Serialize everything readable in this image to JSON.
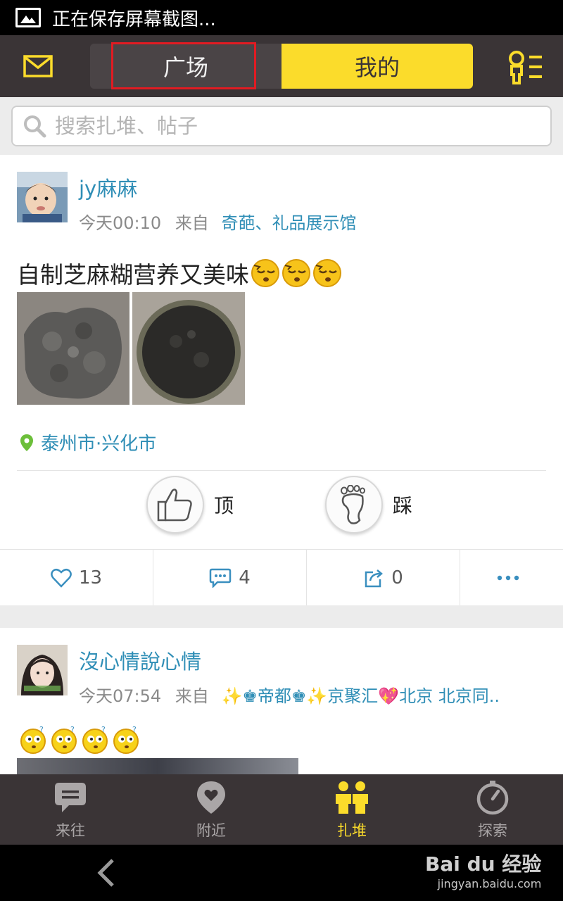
{
  "status_bar": {
    "text": "正在保存屏幕截图..."
  },
  "header": {
    "tabs": [
      {
        "label": "广场"
      },
      {
        "label": "我的"
      }
    ]
  },
  "search": {
    "placeholder": "搜索扎堆、帖子"
  },
  "posts": [
    {
      "username": "jy麻麻",
      "time": "今天00:10",
      "from_label": "来自",
      "from": "奇葩、礼品展示馆",
      "text": "自制芝麻糊营养又美味",
      "location": "泰州市·兴化市",
      "vote_up": "顶",
      "vote_down": "踩",
      "likes": "13",
      "comments": "4",
      "shares": "0"
    },
    {
      "username": "沒心情說心情",
      "time": "今天07:54",
      "from_label": "来自",
      "from": "✨♚帝都♚✨京聚汇💖北京 北京同.."
    }
  ],
  "bottom_nav": [
    {
      "label": "来往",
      "icon": "chat-bubble-icon"
    },
    {
      "label": "附近",
      "icon": "location-heart-icon"
    },
    {
      "label": "扎堆",
      "icon": "group-icon",
      "active": true
    },
    {
      "label": "探索",
      "icon": "compass-icon"
    }
  ],
  "watermark": {
    "brand": "Bai du 经验",
    "url": "jingyan.baidu.com"
  },
  "colors": {
    "accent_yellow": "#fbdc2b",
    "header_dark": "#3a3436",
    "link_blue": "#2f8eb6",
    "highlight_red": "#e11b22"
  }
}
